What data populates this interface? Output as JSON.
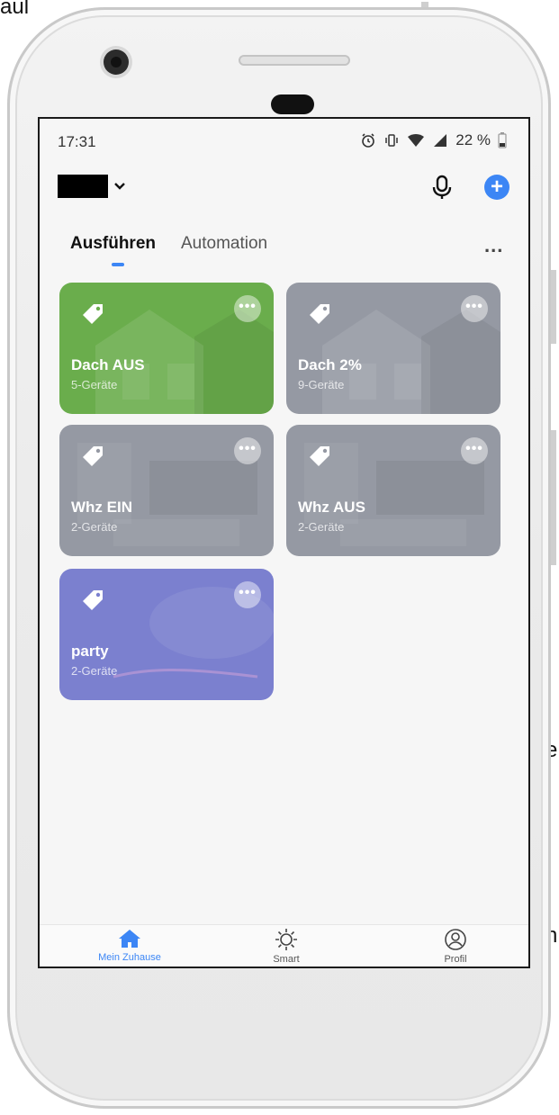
{
  "background_fragments": [
    "aul",
    "e",
    "n"
  ],
  "status_bar": {
    "time": "17:31",
    "battery": "22 %"
  },
  "header": {
    "home_name": "",
    "mic_icon": "mic-icon",
    "add_icon": "plus-circle-icon"
  },
  "tabs": [
    {
      "label": "Ausführen",
      "active": true
    },
    {
      "label": "Automation",
      "active": false
    }
  ],
  "tabs_more": "...",
  "scenes": [
    {
      "title": "Dach AUS",
      "subtitle": "5-Geräte",
      "color": "#6aad4c"
    },
    {
      "title": "Dach 2%",
      "subtitle": "9-Geräte",
      "color": "#9599a3"
    },
    {
      "title": "Whz EIN",
      "subtitle": "2-Geräte",
      "color": "#9599a3"
    },
    {
      "title": "Whz AUS",
      "subtitle": "2-Geräte",
      "color": "#9599a3"
    },
    {
      "title": "party",
      "subtitle": "2-Geräte",
      "color": "#7b80cf"
    }
  ],
  "bottom_nav": [
    {
      "label": "Mein Zuhause",
      "icon": "home-icon",
      "active": true
    },
    {
      "label": "Smart",
      "icon": "sun-icon",
      "active": false
    },
    {
      "label": "Profil",
      "icon": "profile-icon",
      "active": false
    }
  ],
  "colors": {
    "accent": "#3c86f5"
  }
}
